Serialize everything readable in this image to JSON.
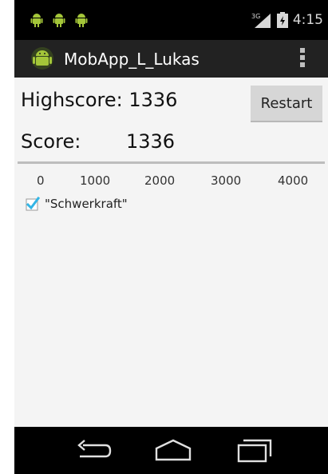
{
  "status_bar": {
    "notification_icons": [
      "android-icon",
      "android-icon",
      "android-icon"
    ],
    "network_label": "3G",
    "time": "4:15"
  },
  "action_bar": {
    "app_icon": "android-icon",
    "title": "MobApp_L_Lukas",
    "overflow_icon": "overflow-menu-icon"
  },
  "scores": {
    "highscore_label": "Highscore: 1336",
    "score_label": "Score:",
    "score_value": "1336",
    "restart_label": "Restart"
  },
  "graph": {
    "axis_ticks": [
      "0",
      "1000",
      "2000",
      "3000",
      "4000"
    ],
    "legend": {
      "label": "\"Schwerkraft\"",
      "checked": true
    }
  },
  "nav_bar": {
    "back_icon": "back-icon",
    "home_icon": "home-icon",
    "recents_icon": "recents-icon"
  },
  "colors": {
    "content_bg": "#f4f4f4",
    "action_bar_bg": "#222222",
    "android_green": "#a4c639",
    "checkbox_blue": "#33b5e5"
  }
}
